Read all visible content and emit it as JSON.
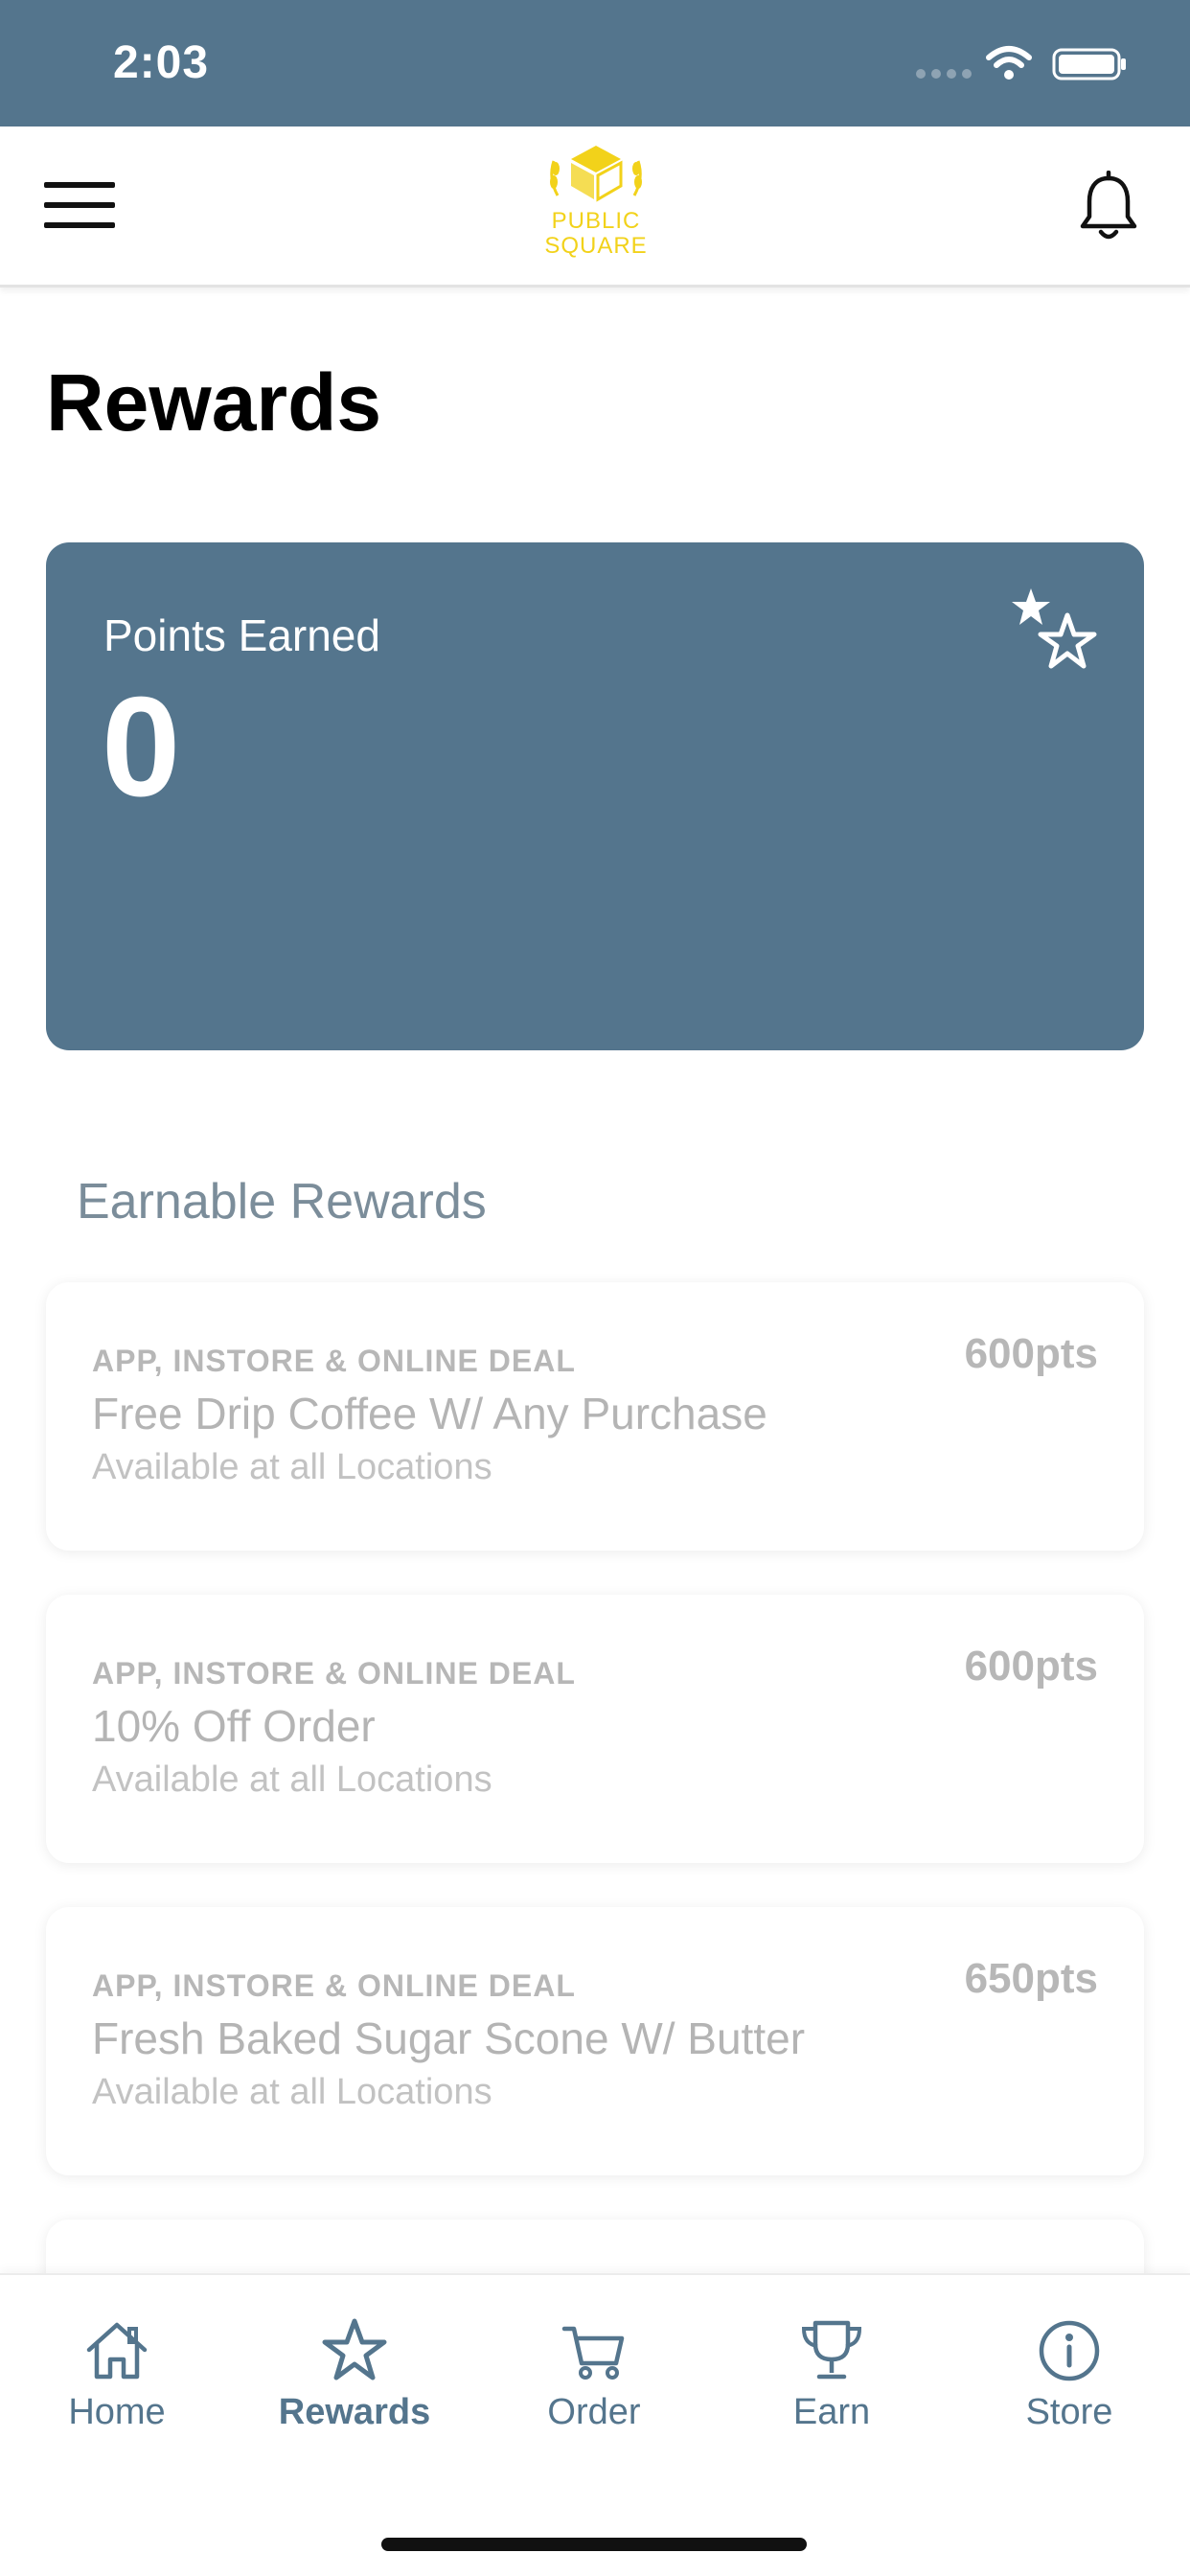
{
  "status_bar": {
    "time": "2:03"
  },
  "header": {
    "logo_line1": "PUBLIC",
    "logo_line2": "SQUARE",
    "brand_color": "#f2d21a"
  },
  "page": {
    "title": "Rewards"
  },
  "points_card": {
    "label": "Points Earned",
    "value": "0",
    "color": "#54758d"
  },
  "earnable": {
    "heading": "Earnable Rewards",
    "rewards": [
      {
        "type": "APP, INSTORE & ONLINE DEAL",
        "title": "Free Drip Coffee W/ Any Purchase",
        "location": "Available at all Locations",
        "points": "600pts"
      },
      {
        "type": "APP, INSTORE & ONLINE DEAL",
        "title": "10% Off Order",
        "location": "Available at all Locations",
        "points": "600pts"
      },
      {
        "type": "APP, INSTORE & ONLINE DEAL",
        "title": "Fresh Baked Sugar Scone W/ Butter",
        "location": "Available at all Locations",
        "points": "650pts"
      }
    ]
  },
  "tab_bar": {
    "tabs": [
      {
        "label": "Home",
        "icon": "home-icon"
      },
      {
        "label": "Rewards",
        "icon": "star-icon",
        "active": true
      },
      {
        "label": "Order",
        "icon": "cart-icon"
      },
      {
        "label": "Earn",
        "icon": "trophy-icon"
      },
      {
        "label": "Store",
        "icon": "info-icon"
      }
    ],
    "accent": "#54758d"
  }
}
